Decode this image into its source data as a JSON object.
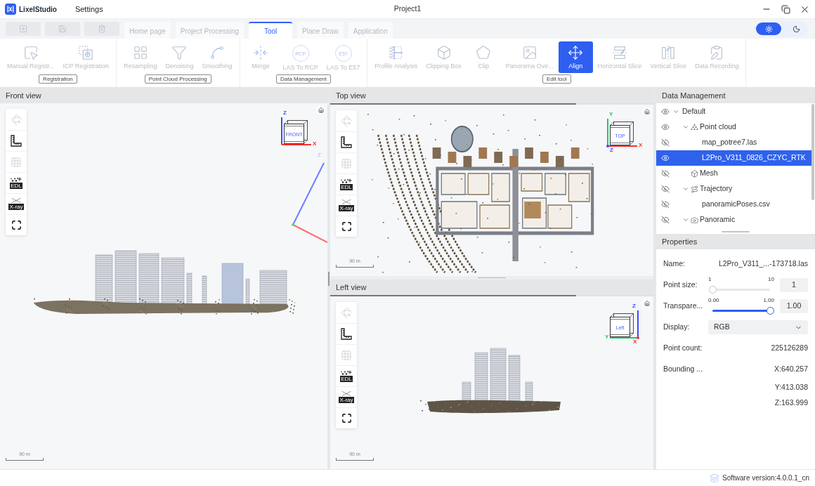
{
  "title_bar": {
    "app_name": "LixelStudio",
    "menu": [
      {
        "label": "Settings"
      }
    ],
    "title": "Project1",
    "window_controls": [
      {
        "kind": "minimize"
      },
      {
        "kind": "restore"
      },
      {
        "kind": "close"
      }
    ]
  },
  "quick_actions": [
    {
      "kind": "new",
      "disabled": true
    },
    {
      "kind": "save",
      "disabled": true
    },
    {
      "kind": "delete",
      "disabled": true
    }
  ],
  "tabs": [
    {
      "label": "Home page",
      "selected": false
    },
    {
      "label": "Project Processing",
      "selected": false
    },
    {
      "label": "Tool",
      "selected": true
    },
    {
      "label": "Plane Draw",
      "selected": false
    },
    {
      "label": "Application",
      "selected": false
    }
  ],
  "theme_toggle": [
    {
      "kind": "light",
      "selected": true
    },
    {
      "kind": "dark",
      "selected": false
    }
  ],
  "ribbon": [
    {
      "label": "Registration",
      "tools": [
        {
          "kind": "manual_registration",
          "label": "Manual Registr...",
          "disabled": true,
          "selected": false
        },
        {
          "kind": "icp_registration",
          "label": "ICP Registration",
          "disabled": true,
          "selected": false
        }
      ]
    },
    {
      "label": "Point Cloud Processing",
      "tools": [
        {
          "kind": "resampling",
          "label": "Resampling",
          "disabled": true,
          "selected": false
        },
        {
          "kind": "denoising",
          "label": "Denoising",
          "disabled": true,
          "selected": false
        },
        {
          "kind": "smoothing",
          "label": "Smoothing",
          "disabled": true,
          "selected": false
        }
      ]
    },
    {
      "label": "Data Management",
      "tools": [
        {
          "kind": "merge",
          "label": "Merge",
          "disabled": true,
          "selected": false
        },
        {
          "kind": "convert",
          "label": "LAS To RCP",
          "icon_text": "RCP",
          "disabled": true,
          "selected": false
        },
        {
          "kind": "convert",
          "label": "LAS To E57",
          "icon_text": "E57",
          "disabled": true,
          "selected": false
        }
      ]
    },
    {
      "label": "Edit tool",
      "tools": [
        {
          "kind": "profile_analysis",
          "label": "Profile Analysis",
          "disabled": true,
          "selected": false
        },
        {
          "kind": "clipping_box",
          "label": "Clipping Box",
          "disabled": true,
          "selected": false
        },
        {
          "kind": "clip",
          "label": "Clip",
          "disabled": true,
          "selected": false
        },
        {
          "kind": "panorama",
          "label": "Panorama Ove...",
          "disabled": true,
          "selected": false
        },
        {
          "kind": "align",
          "label": "Align",
          "disabled": false,
          "selected": true
        },
        {
          "kind": "horizontal_slice",
          "label": "Horizontal Slice",
          "disabled": true,
          "selected": false
        },
        {
          "kind": "vertical_slice",
          "label": "Vertical Slice",
          "disabled": true,
          "selected": false
        },
        {
          "kind": "data_recording",
          "label": "Data Recording",
          "disabled": true,
          "selected": false
        }
      ]
    }
  ],
  "views": [
    {
      "kind": "front",
      "title": "Front view",
      "cube": {
        "face": "FRONT",
        "axes": [
          {
            "kind": "up",
            "label": "Z",
            "color": "#3b4cff"
          },
          {
            "kind": "right",
            "label": "X",
            "color": "#ff3030"
          }
        ]
      },
      "axis_gizmo": {
        "label": "Z"
      },
      "scale_label": "90 m",
      "toolbar": [
        {
          "kind": "orbit",
          "disabled": true
        },
        {
          "kind": "measure",
          "disabled": false
        },
        {
          "kind": "grid",
          "disabled": true
        },
        {
          "kind": "edl",
          "label": "EDL",
          "disabled": false
        },
        {
          "kind": "xray",
          "label": "X-ray",
          "disabled": false
        },
        {
          "kind": "fullscreen",
          "disabled": false
        }
      ]
    },
    {
      "kind": "top",
      "title": "Top view",
      "progress": {
        "level": 0.76
      },
      "cube": {
        "face": "TOP",
        "axes": [
          {
            "kind": "up",
            "label": "Y",
            "color": "#22c55e"
          },
          {
            "kind": "right",
            "label": "X",
            "color": "#ff3030"
          },
          {
            "kind": "toward",
            "label": "Z",
            "color": "#3b4cff"
          }
        ]
      },
      "scale_label": "90 m",
      "toolbar": [
        {
          "kind": "orbit",
          "disabled": true
        },
        {
          "kind": "measure",
          "disabled": false
        },
        {
          "kind": "grid",
          "disabled": true
        },
        {
          "kind": "edl",
          "label": "EDL",
          "disabled": false
        },
        {
          "kind": "xray",
          "label": "X-ray",
          "disabled": false
        },
        {
          "kind": "fullscreen",
          "disabled": false
        }
      ]
    },
    {
      "kind": "left",
      "title": "Left view",
      "progress": {
        "level": 0.76
      },
      "cube": {
        "face": "Left",
        "axes": [
          {
            "kind": "up",
            "label": "Z",
            "color": "#3b4cff"
          },
          {
            "kind": "left",
            "label": "Y",
            "color": "#22c55e"
          },
          {
            "kind": "toward",
            "label": "X",
            "color": "#ff3030"
          }
        ]
      },
      "scale_label": "90 m",
      "toolbar": [
        {
          "kind": "orbit",
          "disabled": true
        },
        {
          "kind": "measure",
          "disabled": false
        },
        {
          "kind": "grid",
          "disabled": true
        },
        {
          "kind": "edl",
          "label": "EDL",
          "disabled": false
        },
        {
          "kind": "xray",
          "label": "X-ray",
          "disabled": false
        },
        {
          "kind": "fullscreen",
          "disabled": false
        }
      ]
    }
  ],
  "data_management": {
    "title": "Data Management",
    "tree": [
      {
        "label": "Default",
        "visible": true,
        "expanded": true,
        "selected": false,
        "children": [
          {
            "kind": "point_cloud",
            "label": "Point cloud",
            "visible": true,
            "expanded": true,
            "selected": false,
            "children": [
              {
                "label": "map_potree7.las",
                "visible": false,
                "selected": false
              },
              {
                "label": "L2Pro_V311_0826_CZYC_RTK",
                "visible": true,
                "selected": true
              }
            ]
          },
          {
            "kind": "mesh",
            "label": "Mesh",
            "visible": false,
            "selected": false
          },
          {
            "kind": "trajectory",
            "label": "Trajectory",
            "visible": false,
            "expanded": true,
            "selected": false,
            "children": [
              {
                "label": "panoramicPoses.csv",
                "visible": false,
                "selected": false
              }
            ]
          },
          {
            "kind": "panoramic",
            "label": "Panoramic",
            "visible": false,
            "expanded": true,
            "selected": false
          }
        ]
      }
    ]
  },
  "properties": {
    "title": "Properties",
    "rows": [
      {
        "kind": "text",
        "label": "Name:",
        "value": "L2Pro_V311_...-173718.las"
      },
      {
        "kind": "slider",
        "label": "Point size:",
        "min": "1",
        "max": "10",
        "level": 0,
        "value": "1",
        "disabled": true
      },
      {
        "kind": "slider",
        "label": "Transpare...",
        "min": "0.00",
        "max": "1.00",
        "level": 1,
        "value": "1.00",
        "disabled": false
      },
      {
        "kind": "select",
        "label": "Display:",
        "value": "RGB"
      },
      {
        "kind": "text",
        "label": "Point count:",
        "value": "225126289"
      },
      {
        "kind": "lines",
        "label": "Bounding ...",
        "values": [
          "X:640.257",
          "Y:413.038",
          "Z:163.999"
        ]
      }
    ]
  },
  "status_bar": {
    "version": "Software version:4.0.0.1_cn"
  }
}
